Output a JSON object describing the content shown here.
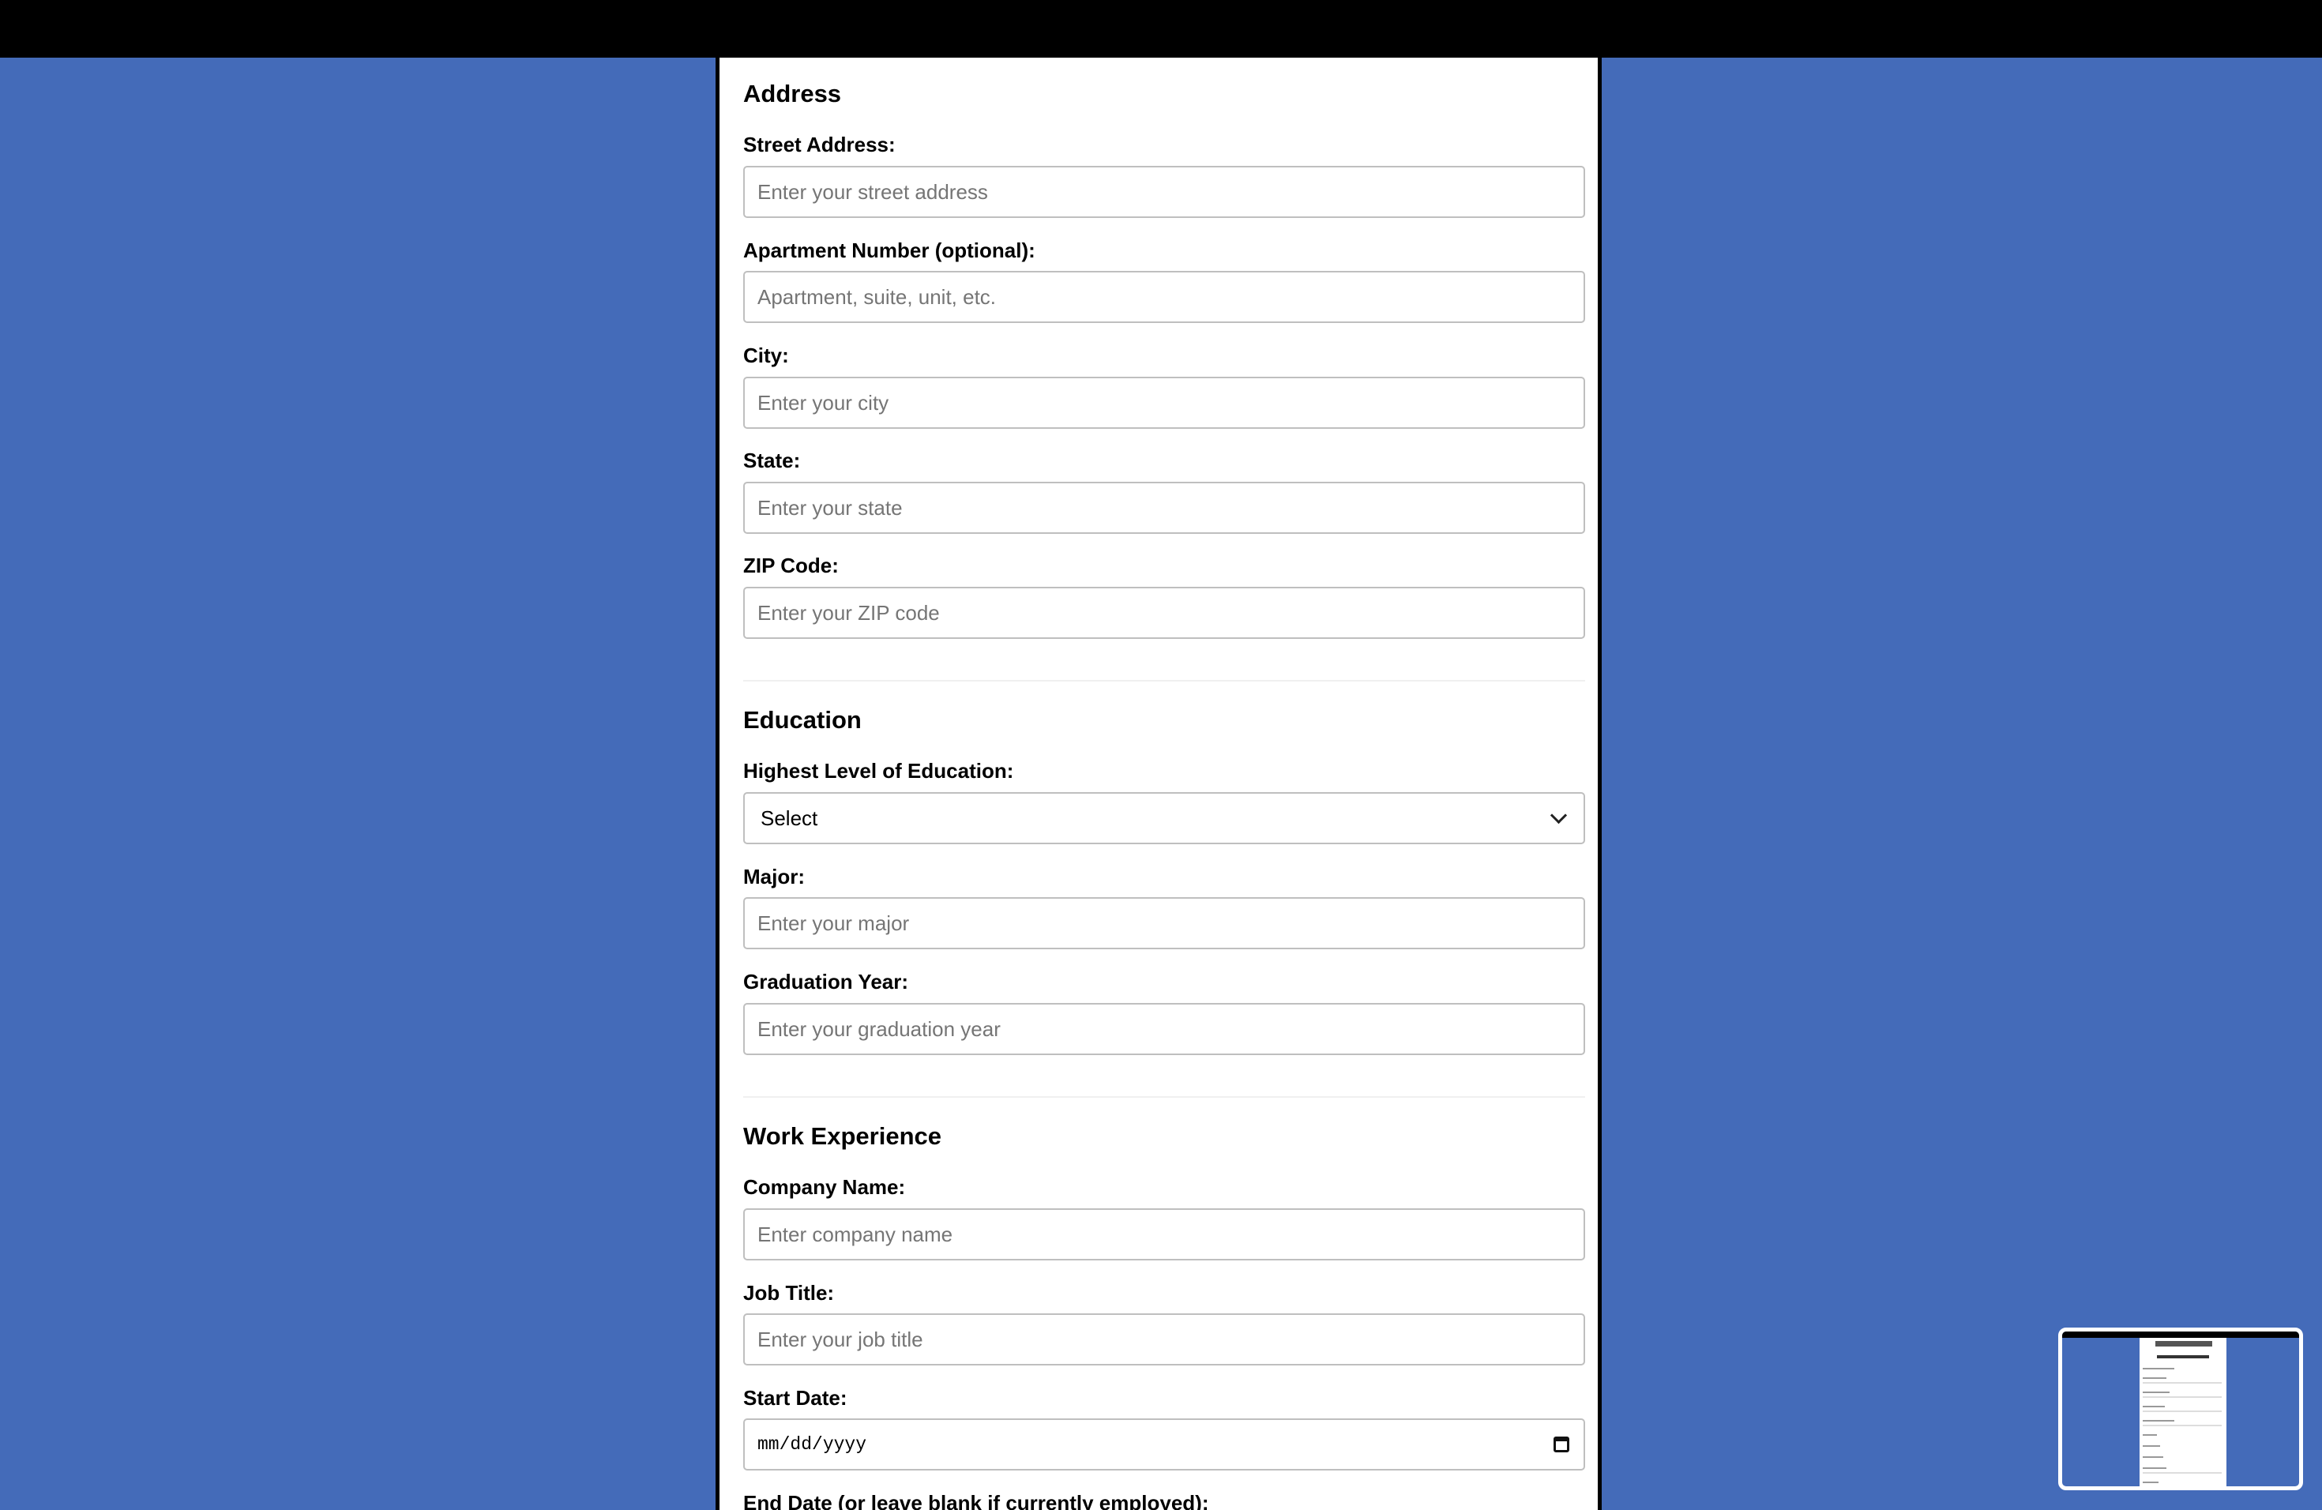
{
  "sections": {
    "address": {
      "title": "Address",
      "street": {
        "label": "Street Address:",
        "placeholder": "Enter your street address"
      },
      "apartment": {
        "label": "Apartment Number (optional):",
        "placeholder": "Apartment, suite, unit, etc."
      },
      "city": {
        "label": "City:",
        "placeholder": "Enter your city"
      },
      "state": {
        "label": "State:",
        "placeholder": "Enter your state"
      },
      "zip": {
        "label": "ZIP Code:",
        "placeholder": "Enter your ZIP code"
      }
    },
    "education": {
      "title": "Education",
      "level": {
        "label": "Highest Level of Education:",
        "selected": "Select"
      },
      "major": {
        "label": "Major:",
        "placeholder": "Enter your major"
      },
      "graduation_year": {
        "label": "Graduation Year:",
        "placeholder": "Enter your graduation year"
      }
    },
    "work": {
      "title": "Work Experience",
      "company": {
        "label": "Company Name:",
        "placeholder": "Enter company name"
      },
      "job_title": {
        "label": "Job Title:",
        "placeholder": "Enter your job title"
      },
      "start_date": {
        "label": "Start Date:",
        "value": "mm/dd/yyyy"
      },
      "end_date": {
        "label": "End Date (or leave blank if currently employed):"
      }
    }
  },
  "icons": {
    "select_arrow": "chevron-down-icon",
    "date_picker": "calendar-icon"
  },
  "colors": {
    "background": "#446bb9",
    "topbar": "#000000",
    "card": "#ffffff"
  }
}
